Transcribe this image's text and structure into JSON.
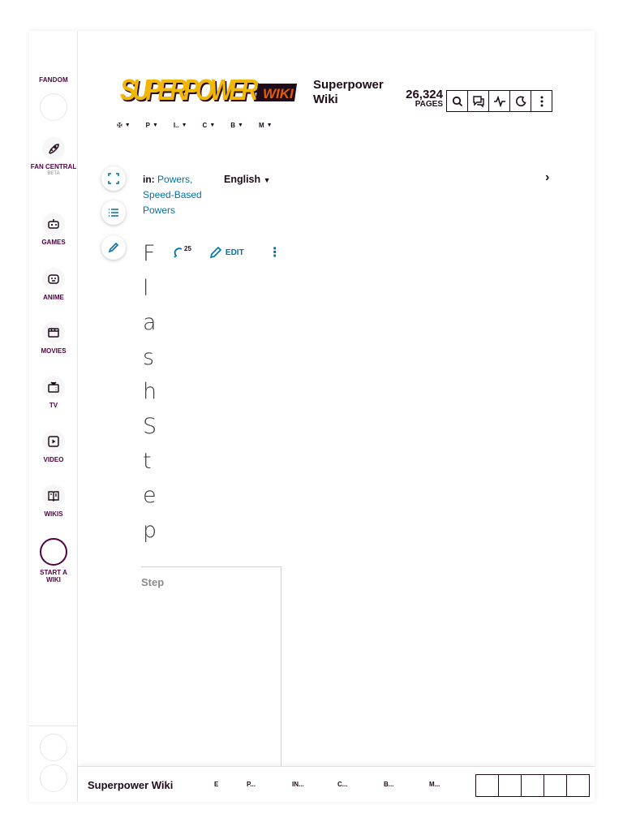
{
  "global_nav": {
    "fandom_label": "FANDOM",
    "items": [
      {
        "icon": "rocket-icon",
        "label": "FAN CENTRAL",
        "sub": "BETA"
      },
      {
        "icon": "gamepad-icon",
        "label": "GAMES"
      },
      {
        "icon": "anime-icon",
        "label": "ANIME"
      },
      {
        "icon": "clapperboard-icon",
        "label": "MOVIES"
      },
      {
        "icon": "tv-icon",
        "label": "TV"
      },
      {
        "icon": "play-icon",
        "label": "VIDEO"
      },
      {
        "icon": "book-icon",
        "label": "WIKIS"
      }
    ],
    "start_wiki_label": "START A WIKI"
  },
  "header": {
    "wordmark_text": "SUPERPOWER WIKI",
    "site_name": "Superpower Wiki",
    "page_count": "26,324",
    "page_count_label": "PAGES",
    "tools": [
      "search-icon",
      "discussion-icon",
      "activity-icon",
      "theme-icon",
      "more-icon"
    ]
  },
  "local_nav": [
    "✠",
    "P",
    "I..",
    "C",
    "B",
    "M"
  ],
  "page_tools": [
    "fullscreen-icon",
    "toc-icon",
    "edit-icon"
  ],
  "categories": {
    "prefix": "in:",
    "items": [
      "Powers,",
      "Speed-Based Powers"
    ]
  },
  "language": "English",
  "article": {
    "title_chars": [
      "F",
      "l",
      "a",
      "s",
      "h",
      "S",
      "t",
      "e",
      "p"
    ],
    "comment_count": "25",
    "edit_label": "EDIT"
  },
  "infobox": {
    "caption": "Step"
  },
  "sticky_bar": {
    "site_name": "Superpower Wiki",
    "nav": [
      "E",
      "P...",
      "IN...",
      "C...",
      "B...",
      "M..."
    ]
  },
  "colors": {
    "fandom_purple": "#520044",
    "link_blue": "#0072a8",
    "wordmark_yellow": "#f2b705",
    "wordmark_orange": "#e35d00"
  }
}
